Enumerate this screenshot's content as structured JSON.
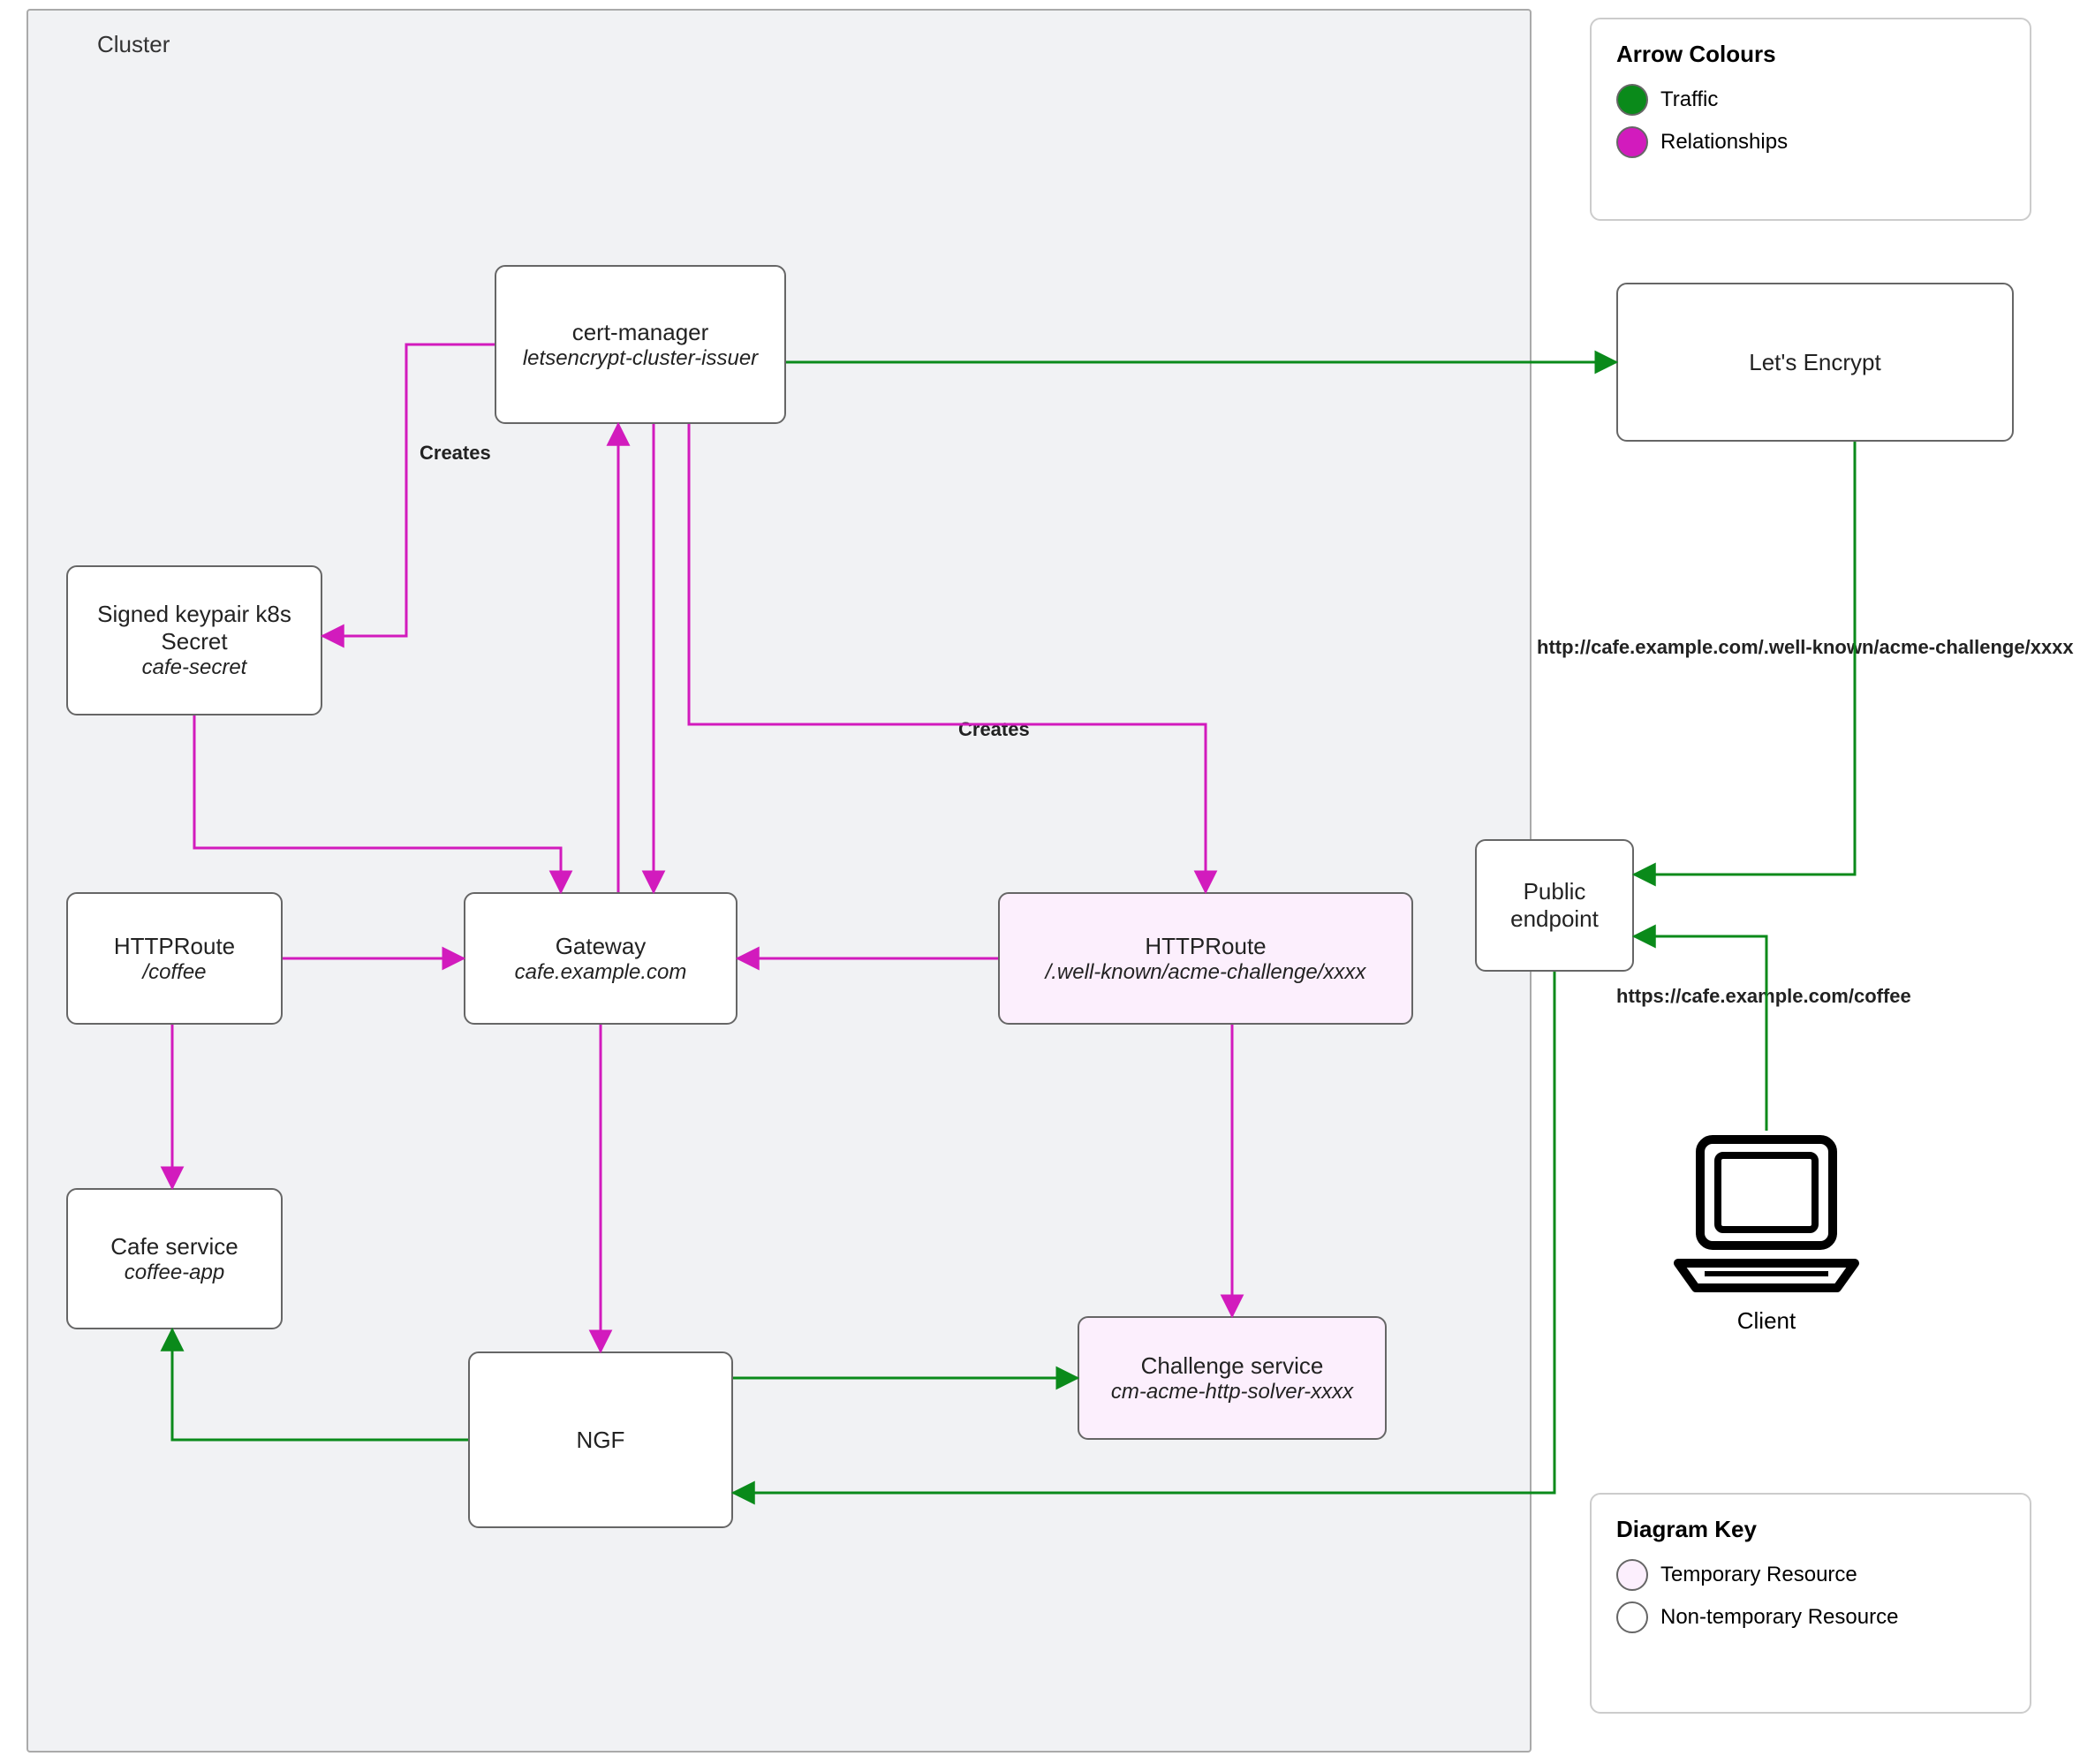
{
  "cluster": {
    "label": "Cluster"
  },
  "nodes": {
    "certManager": {
      "title": "cert-manager",
      "sub": "letsencrypt-cluster-issuer"
    },
    "secret": {
      "title": "Signed keypair k8s Secret",
      "sub": "cafe-secret"
    },
    "httprouteCoffee": {
      "title": "HTTPRoute",
      "sub": "/coffee"
    },
    "gateway": {
      "title": "Gateway",
      "sub": "cafe.example.com"
    },
    "httprouteAcme": {
      "title": "HTTPRoute",
      "sub": "/.well-known/acme-challenge/xxxx"
    },
    "cafeService": {
      "title": "Cafe service",
      "sub": "coffee-app"
    },
    "ngf": {
      "title": "NGF",
      "sub": ""
    },
    "challenge": {
      "title": "Challenge service",
      "sub": "cm-acme-http-solver-xxxx"
    },
    "letsEncrypt": {
      "title": "Let's Encrypt",
      "sub": ""
    },
    "publicEndpoint": {
      "title": "Public endpoint",
      "sub": ""
    }
  },
  "labels": {
    "creates1": "Creates",
    "creates2": "Creates",
    "acmeUrl": "http://cafe.example.com/.well-known/acme-challenge/xxxx",
    "httpsUrl": "https://cafe.example.com/coffee",
    "client": "Client"
  },
  "legend1": {
    "title": "Arrow Colours",
    "items": [
      {
        "label": "Traffic",
        "color": "#0a8a1a"
      },
      {
        "label": "Relationships",
        "color": "#d21bbd"
      }
    ]
  },
  "legend2": {
    "title": "Diagram Key",
    "items": [
      {
        "label": "Temporary Resource",
        "fill": "#fceffd"
      },
      {
        "label": "Non-temporary Resource",
        "fill": "#ffffff"
      }
    ]
  },
  "colors": {
    "traffic": "#0a8a1a",
    "relationship": "#d21bbd"
  }
}
